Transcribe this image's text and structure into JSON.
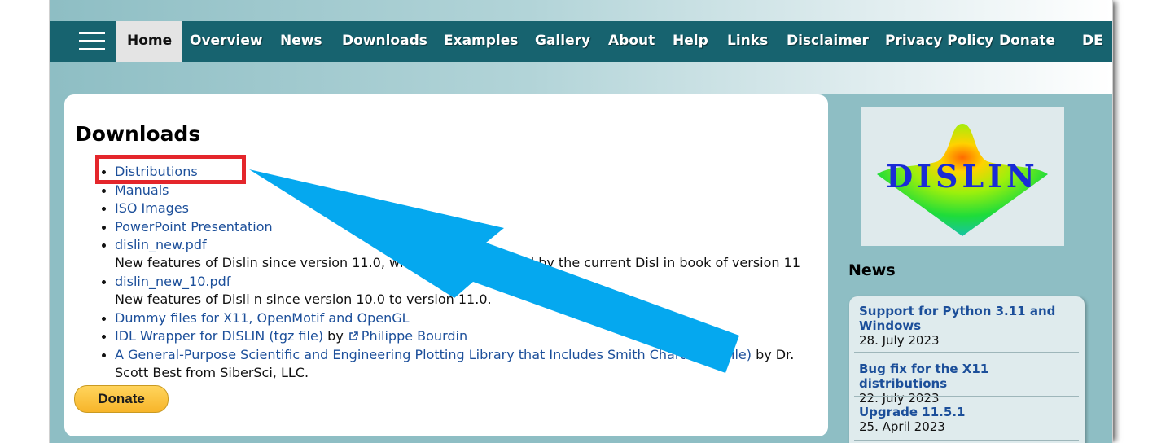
{
  "nav": {
    "items": [
      {
        "label": "Home",
        "active": true
      },
      {
        "label": "Overview"
      },
      {
        "label": "News"
      },
      {
        "label": "Downloads"
      },
      {
        "label": "Examples"
      },
      {
        "label": "Gallery"
      },
      {
        "label": "About"
      },
      {
        "label": "Help"
      },
      {
        "label": "Links"
      },
      {
        "label": "Disclaimer"
      },
      {
        "label": "Privacy Policy"
      },
      {
        "label": "Donate"
      },
      {
        "label": "DE"
      }
    ]
  },
  "main": {
    "title": "Downloads",
    "items": [
      {
        "link": "Distributions"
      },
      {
        "link": "Manuals"
      },
      {
        "link": "ISO Images"
      },
      {
        "link": "PowerPoint Presentation"
      },
      {
        "link": "dislin_new.pdf",
        "desc": "New features of Dislin since version 11.0, which are not covered by the current Disl in book of version 11"
      },
      {
        "link": "dislin_new_10.pdf",
        "desc": "New features of Disli n since version 10.0 to version 11.0."
      },
      {
        "link": "Dummy files for X11, OpenMotif and OpenGL"
      },
      {
        "link": "IDL Wrapper for DISLIN (tgz file)",
        "by": "by",
        "author": "Philippe Bourdin"
      },
      {
        "link": "A General-Purpose Scientific and Engineering Plotting Library that Includes Smith Charts (pdf file)",
        "after": "by Dr. Scott Best from SiberSci, LLC."
      }
    ],
    "donate_label": "Donate"
  },
  "sidebar": {
    "logo_text": "DISLIN",
    "news_title": "News",
    "news": [
      {
        "title": "Support for Python 3.11 and Windows",
        "date": "28. July 2023"
      },
      {
        "title": "Bug fix for the X11 distributions",
        "date": "22. July 2023"
      },
      {
        "title": "Upgrade 11.5.1",
        "date": "25. April 2023"
      }
    ]
  },
  "colors": {
    "nav_bg": "#17636f",
    "page_bg": "#8ebec4",
    "link": "#1c4f9a",
    "highlight": "#e4262b",
    "arrow": "#05a8ef"
  },
  "icons": {
    "menu": "hamburger-icon",
    "external": "external-link-icon"
  }
}
